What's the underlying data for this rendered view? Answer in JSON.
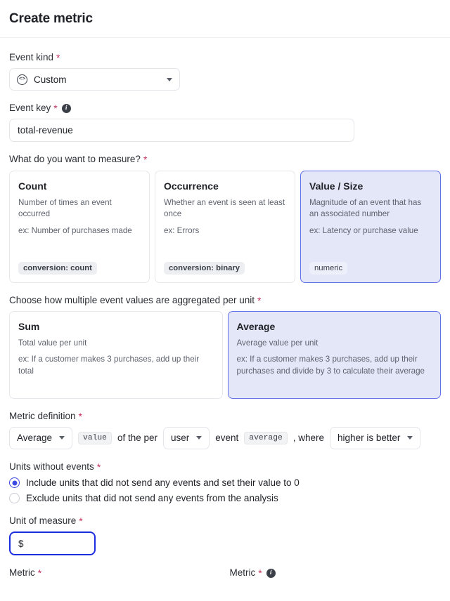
{
  "header": {
    "title": "Create metric"
  },
  "event_kind": {
    "label": "Event kind",
    "required": "*",
    "icon": "code-circle-icon",
    "value": "Custom"
  },
  "event_key": {
    "label": "Event key",
    "required": "*",
    "info_icon": "i",
    "value": "total-revenue",
    "placeholder": "total-revenue"
  },
  "measure": {
    "label": "What do you want to measure?",
    "required": "*",
    "options": [
      {
        "title": "Count",
        "desc": "Number of times an event occurred",
        "example": "ex: Number of purchases made",
        "chip": "conversion: count",
        "selected": false
      },
      {
        "title": "Occurrence",
        "desc": "Whether an event is seen at least once",
        "example": "ex: Errors",
        "chip": "conversion: binary",
        "selected": false
      },
      {
        "title": "Value / Size",
        "desc": "Magnitude of an event that has an associated number",
        "example": "ex: Latency or purchase value",
        "chip": "numeric",
        "selected": true
      }
    ]
  },
  "aggregation": {
    "label": "Choose how multiple event values are aggregated per unit",
    "required": "*",
    "options": [
      {
        "title": "Sum",
        "desc": "Total value per unit",
        "example": "ex: If a customer makes 3 purchases, add up their total",
        "selected": false
      },
      {
        "title": "Average",
        "desc": "Average value per unit",
        "example": "ex: If a customer makes 3 purchases, add up their purchases and divide by 3 to calculate their average",
        "selected": true
      }
    ]
  },
  "definition": {
    "label": "Metric definition",
    "required": "*",
    "aggregation_select": "Average",
    "value_chip": "value",
    "text_of_the_per": "of the per",
    "unit_select": "user",
    "text_event": "event",
    "average_chip": "average",
    "text_where": ", where",
    "direction_select": "higher is better"
  },
  "units_without_events": {
    "label": "Units without events",
    "required": "*",
    "options": [
      {
        "label": "Include units that did not send any events and set their value to 0",
        "checked": true
      },
      {
        "label": "Exclude units that did not send any events from the analysis",
        "checked": false
      }
    ]
  },
  "unit_of_measure": {
    "label": "Unit of measure",
    "required": "*",
    "value": "$",
    "placeholder": "$"
  },
  "bottom": {
    "left_label": "Metric",
    "left_required": "*",
    "right_label": "Metric",
    "right_required": "*"
  },
  "colors": {
    "accent": "#3b4ae0",
    "selected_card_bg": "#e4e7f8",
    "selected_card_border": "#6470e8",
    "required_asterisk": "#c2305c",
    "focus_border": "#1c2ce0"
  }
}
